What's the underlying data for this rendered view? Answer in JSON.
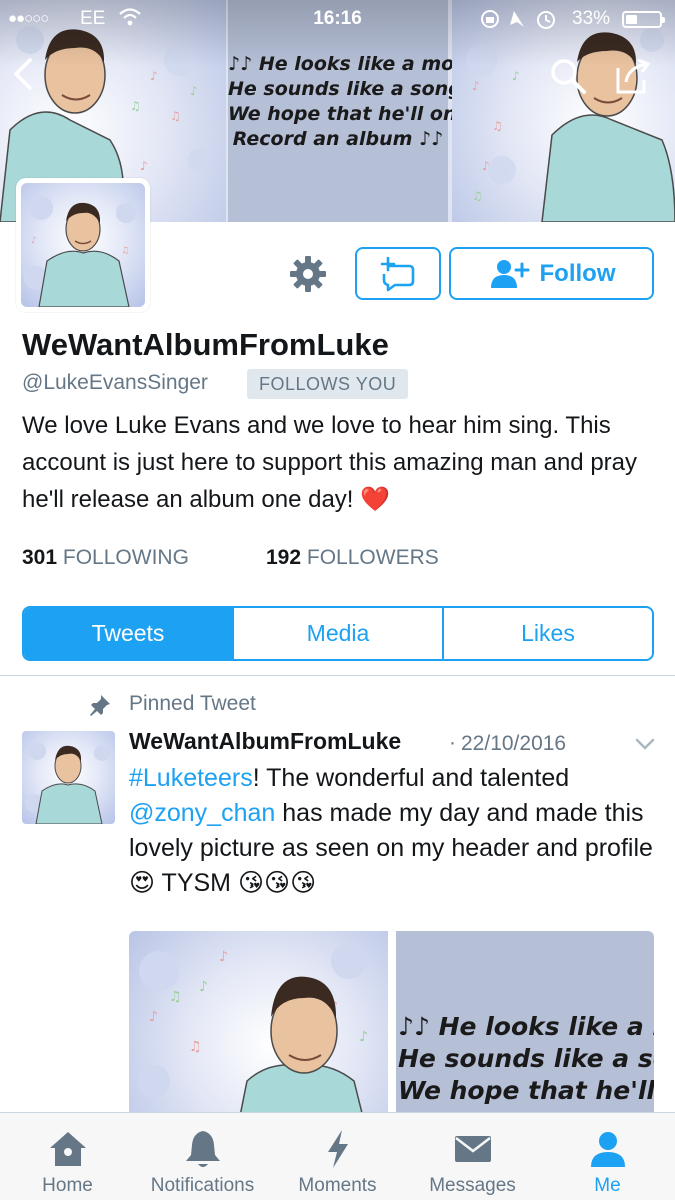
{
  "status_bar": {
    "signal": "●●○○○",
    "carrier": "EE",
    "time": "16:16",
    "battery": "33%",
    "battery_level": 0.33
  },
  "banner": {
    "quote_lines": [
      "♪♪ He looks like a movie",
      "He sounds like a song",
      "We hope that he'll one day",
      "Record an album ♪♪"
    ]
  },
  "profile": {
    "display_name": "WeWantAlbumFromLuke",
    "handle": "@LukeEvansSinger",
    "follows_you": "FOLLOWS YOU",
    "bio": "We love Luke Evans and we love to hear him sing. This account is just here to support this amazing man and pray he'll release an album one day! ",
    "bio_emoji": "❤️",
    "follow_label": "Follow",
    "following_count": "301",
    "following_label": "FOLLOWING",
    "followers_count": "192",
    "followers_label": "FOLLOWERS"
  },
  "tabs": [
    "Tweets",
    "Media",
    "Likes"
  ],
  "tweet": {
    "pinned_label": "Pinned Tweet",
    "name": "WeWantAlbumFromLuke",
    "separator": "·",
    "date": "22/10/2016",
    "hashtag": "#Luketeers",
    "text_1": "! The wonderful and talented ",
    "mention": "@zony_chan",
    "text_2": " has made my day and made this lovely picture as seen on my header and profile ",
    "emoji_1": "😍",
    "text_3": " TYSM ",
    "emoji_2": "😘😘😘",
    "media_quote_lines": [
      "♪♪ He looks like a mo",
      " He sounds like a son",
      "We hope that he'll one"
    ]
  },
  "tabbar": [
    {
      "label": "Home",
      "icon": "home-icon"
    },
    {
      "label": "Notifications",
      "icon": "bell-icon"
    },
    {
      "label": "Moments",
      "icon": "lightning-icon"
    },
    {
      "label": "Messages",
      "icon": "envelope-icon"
    },
    {
      "label": "Me",
      "icon": "person-icon"
    }
  ],
  "colors": {
    "accent": "#1da1f2",
    "secondary_text": "#657786",
    "badge_bg": "#e1e8ed"
  }
}
